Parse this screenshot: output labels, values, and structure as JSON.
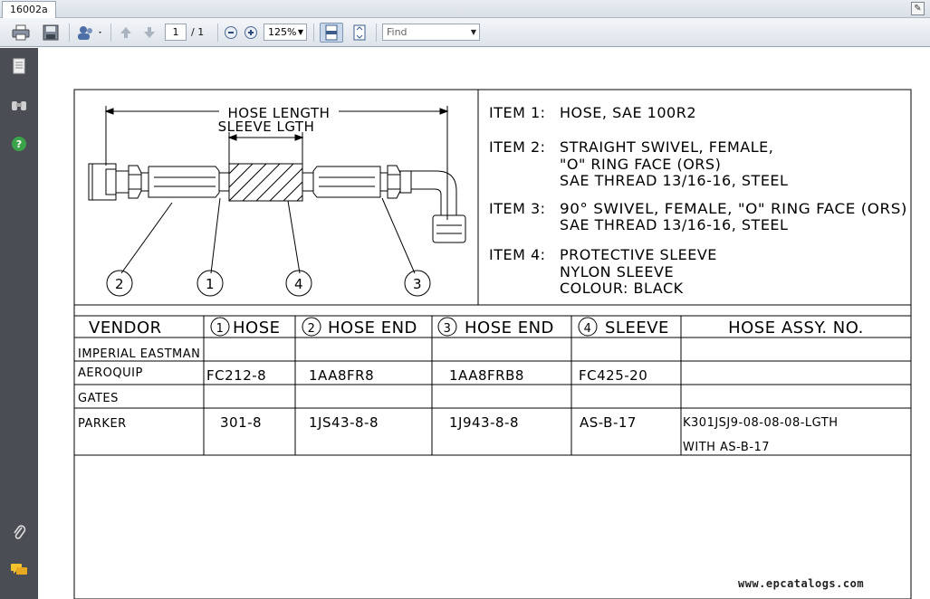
{
  "tab": {
    "title": "16002a"
  },
  "toolbar": {
    "page_current": "1",
    "page_total": "/ 1",
    "zoom": "125%",
    "find_placeholder": "Find"
  },
  "drawing": {
    "hose_length": "HOSE LENGTH",
    "sleeve_length": "SLEEVE LGTH",
    "callouts": [
      "2",
      "1",
      "4",
      "3"
    ]
  },
  "items": [
    {
      "label": "ITEM 1:",
      "lines": [
        "HOSE, SAE 100R2"
      ]
    },
    {
      "label": "ITEM 2:",
      "lines": [
        "STRAIGHT SWIVEL, FEMALE,",
        "\"O\" RING FACE (ORS)",
        "SAE THREAD 13/16-16, STEEL"
      ]
    },
    {
      "label": "ITEM 3:",
      "lines": [
        "90° SWIVEL, FEMALE, \"O\" RING FACE (ORS)",
        "SAE THREAD 13/16-16, STEEL"
      ]
    },
    {
      "label": "ITEM 4:",
      "lines": [
        "PROTECTIVE SLEEVE",
        "NYLON SLEEVE",
        "COLOUR: BLACK"
      ]
    }
  ],
  "table": {
    "headers": [
      {
        "num": "",
        "text": "VENDOR"
      },
      {
        "num": "1",
        "text": "HOSE"
      },
      {
        "num": "2",
        "text": "HOSE END"
      },
      {
        "num": "3",
        "text": "HOSE END"
      },
      {
        "num": "4",
        "text": "SLEEVE"
      },
      {
        "num": "",
        "text": "HOSE ASSY. NO."
      }
    ],
    "rows": [
      {
        "vendor": "IMPERIAL EASTMAN",
        "hose": "",
        "end1": "",
        "end2": "",
        "sleeve": "",
        "assy": []
      },
      {
        "vendor": "AEROQUIP",
        "hose": "FC212-8",
        "end1": "1AA8FR8",
        "end2": "1AA8FRB8",
        "sleeve": "FC425-20",
        "assy": []
      },
      {
        "vendor": "GATES",
        "hose": "",
        "end1": "",
        "end2": "",
        "sleeve": "",
        "assy": []
      },
      {
        "vendor": "PARKER",
        "hose": "301-8",
        "end1": "1JS43-8-8",
        "end2": "1J943-8-8",
        "sleeve": "AS-B-17",
        "assy": [
          "K301JSJ9-08-08-08-LGTH",
          "WITH AS-B-17"
        ]
      }
    ]
  },
  "watermark": "www.epcatalogs.com"
}
